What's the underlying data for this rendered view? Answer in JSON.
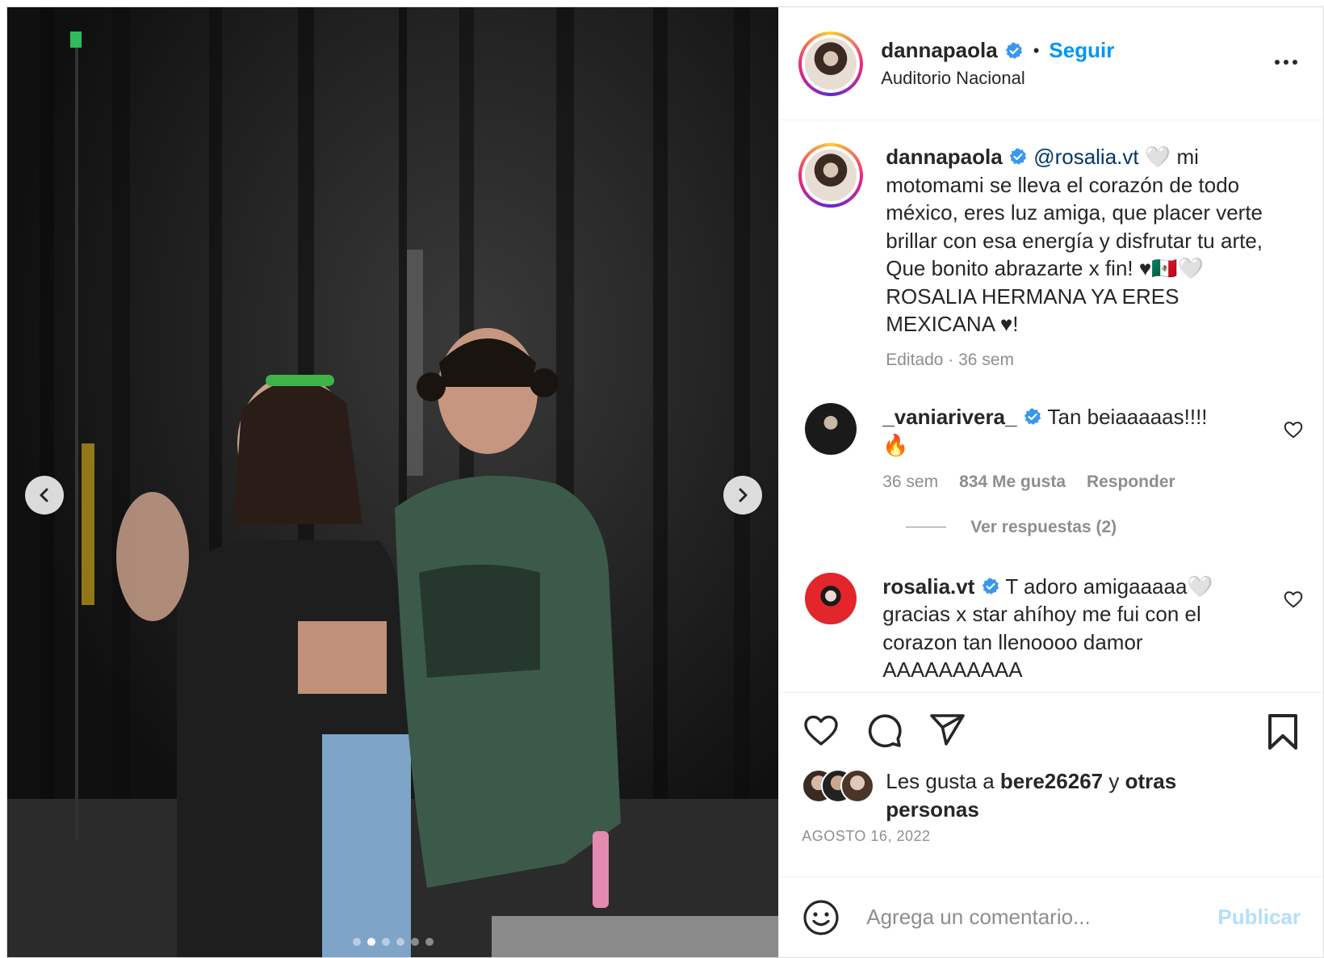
{
  "header": {
    "username": "dannapaola",
    "separator": "•",
    "follow_label": "Seguir",
    "location": "Auditorio Nacional"
  },
  "caption": {
    "username": "dannapaola",
    "mention": "@rosalia.vt",
    "text": " 🤍 mi motomami se lleva el corazón de todo méxico, eres luz amiga, que placer verte brillar con esa energía y disfrutar tu arte, Que bonito abrazarte x fin! ♥🇲🇽🤍 ROSALIA HERMANA YA ERES MEXICANA ♥!",
    "meta": "Editado · 36 sem"
  },
  "comments": [
    {
      "username": "_vaniarivera_",
      "text": "Tan beiaaaaas!!!! 🔥",
      "time": "36 sem",
      "likes": "834 Me gusta",
      "reply_label": "Responder",
      "view_replies": "Ver respuestas (2)"
    },
    {
      "username": "rosalia.vt",
      "text": "T adoro amigaaaaa🤍 gracias x star ahíhoy me fui con el corazon tan llenoooo damor AAAAAAAAAA"
    }
  ],
  "likes": {
    "prefix": "Les gusta a ",
    "user": "bere26267",
    "middle": " y ",
    "suffix": "otras personas"
  },
  "date": "AGOSTO 16, 2022",
  "add_comment": {
    "placeholder": "Agrega un comentario...",
    "publish_label": "Publicar"
  },
  "carousel": {
    "total": 6,
    "active": 1
  },
  "icons": [
    "chevron-left-icon",
    "chevron-right-icon",
    "verified-icon",
    "more-icon",
    "heart-icon",
    "comment-icon",
    "share-icon",
    "bookmark-icon",
    "smile-icon"
  ],
  "colors": {
    "accent": "#0095f6",
    "verified": "#3897f0",
    "mention": "#00376b",
    "muted": "#8e8e8e",
    "publish_disabled": "#b2dffc"
  }
}
